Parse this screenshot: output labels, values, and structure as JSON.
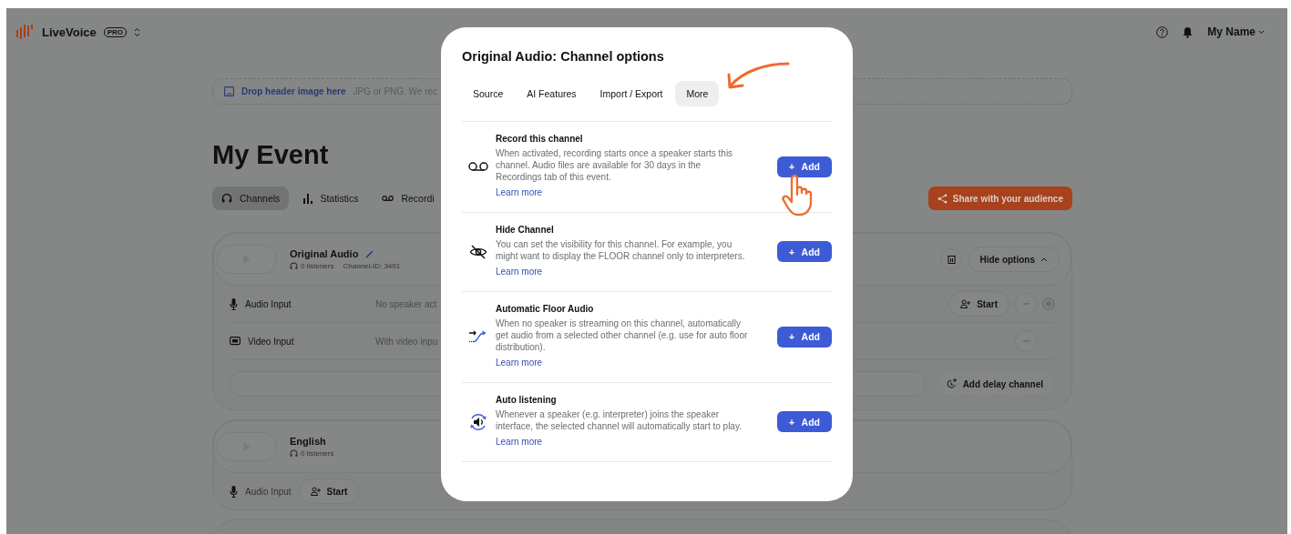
{
  "app": {
    "name": "LiveVoice",
    "badge": "PRO"
  },
  "user": {
    "name": "My Name"
  },
  "header_drop": {
    "link": "Drop header image here",
    "hint": "JPG or PNG. We rec"
  },
  "event_title": "My Event",
  "tabs": [
    {
      "label": "Channels",
      "kind": "headphones",
      "selected": true
    },
    {
      "label": "Statistics",
      "kind": "bars",
      "selected": false
    },
    {
      "label": "Recordi",
      "kind": "record",
      "selected": false
    }
  ],
  "share_button": "Share with your audience",
  "channels": [
    {
      "name": "Original Audio",
      "listeners": "0 listeners",
      "channel_id": "Channel-ID: 3491",
      "hide_button": "Hide options",
      "delay_button": "Add delay channel",
      "inputs": [
        {
          "kind": "audio",
          "label": "Audio Input",
          "status": "No speaker act",
          "action": "Start"
        },
        {
          "kind": "video",
          "label": "Video Input",
          "status": "With video inpu"
        }
      ]
    },
    {
      "name": "English",
      "listeners": "0 listeners",
      "inputs": [
        {
          "kind": "audio",
          "label": "Audio Input",
          "action": "Start"
        }
      ]
    }
  ],
  "modal": {
    "title": "Original Audio: Channel options",
    "tabs": [
      {
        "label": "Source",
        "selected": false
      },
      {
        "label": "AI Features",
        "selected": false
      },
      {
        "label": "Import / Export",
        "selected": false
      },
      {
        "label": "More",
        "selected": true
      }
    ],
    "options": [
      {
        "kind": "record",
        "title": "Record this channel",
        "description": "When activated, recording starts once a speaker starts this channel. Audio files are available for 30 days in the Recordings tab of this event.",
        "link": "Learn more",
        "button": "+ Add"
      },
      {
        "kind": "hide",
        "title": "Hide Channel",
        "description": "You can set the visibility for this channel. For example, you might want to display the FLOOR channel only to interpreters.",
        "link": "Learn more",
        "button": "+ Add"
      },
      {
        "kind": "floor",
        "title": "Automatic Floor Audio",
        "description": "When no speaker is streaming on this channel, automatically get audio from a selected other channel (e.g. use for auto floor distribution).",
        "link": "Learn more",
        "button": "+ Add"
      },
      {
        "kind": "listen",
        "title": "Auto listening",
        "description": "Whenever a speaker (e.g. interpreter) joins the speaker interface, the selected channel will automatically start to play.",
        "link": "Learn more",
        "button": "+ Add"
      }
    ]
  }
}
